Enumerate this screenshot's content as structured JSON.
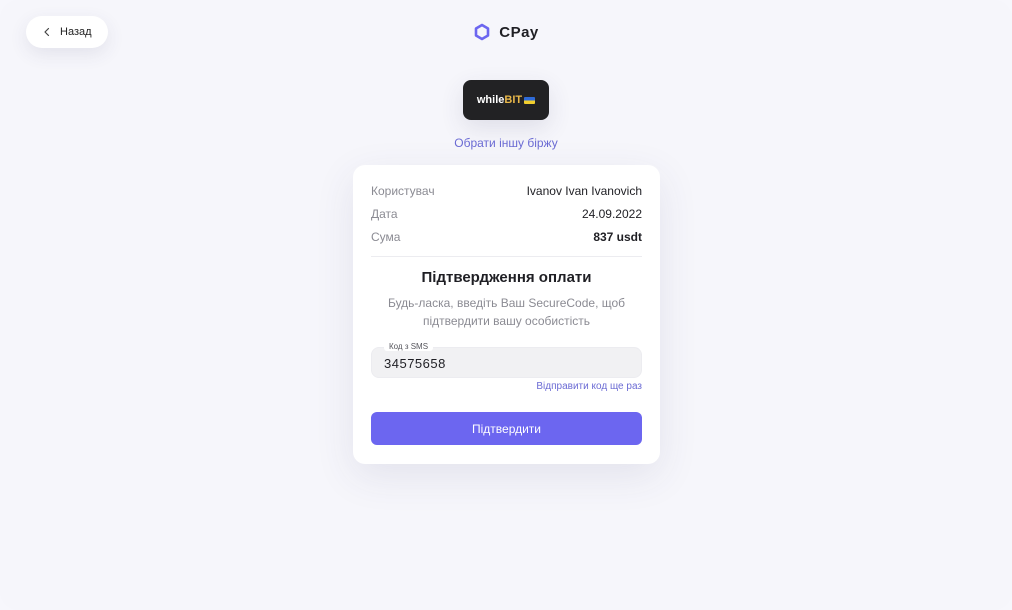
{
  "header": {
    "back_label": "Назад",
    "brand": "CPay"
  },
  "exchange": {
    "name_part1": "while",
    "name_part2": "BIT",
    "change_link": "Обрати іншу біржу"
  },
  "details": [
    {
      "label": "Користувач",
      "value": "Ivanov Ivan Ivanovich"
    },
    {
      "label": "Дата",
      "value": "24.09.2022"
    },
    {
      "label": "Сума",
      "value": "837 usdt"
    }
  ],
  "confirm": {
    "title": "Підтвердження оплати",
    "description": "Будь-ласка, введіть Ваш SecureCode, щоб підтвердити вашу особистість",
    "code_label": "Код з SMS",
    "code_value": "34575658",
    "resend_label": "Відправити код ще раз",
    "submit_label": "Підтвердити"
  },
  "colors": {
    "accent": "#6c66f0",
    "link": "#6b6bd4",
    "background": "#f6f6fb"
  }
}
